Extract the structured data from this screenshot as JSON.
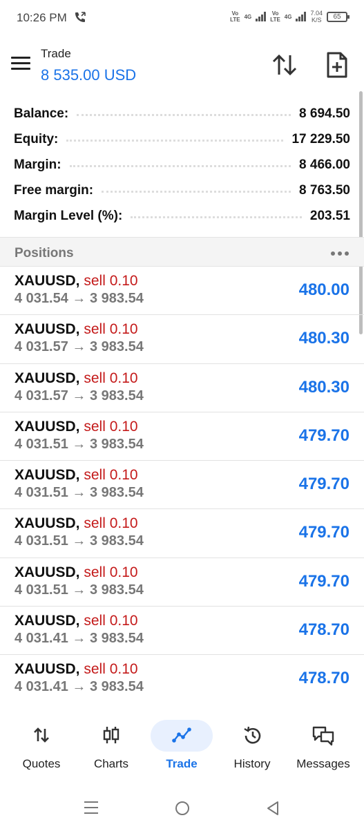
{
  "status_bar": {
    "time": "10:26 PM",
    "network_left": "Vo\nLTE",
    "signal_left": "4G",
    "network_right": "Vo\nLTE",
    "signal_right": "4G",
    "speed_value": "7.04",
    "speed_unit": "K/S",
    "battery": "65"
  },
  "header": {
    "title": "Trade",
    "balance": "8 535.00 USD"
  },
  "account": [
    {
      "label": "Balance:",
      "value": "8 694.50"
    },
    {
      "label": "Equity:",
      "value": "17 229.50"
    },
    {
      "label": "Margin:",
      "value": "8 466.00"
    },
    {
      "label": "Free margin:",
      "value": "8 763.50"
    },
    {
      "label": "Margin Level (%):",
      "value": "203.51"
    }
  ],
  "positions_section": {
    "title": "Positions"
  },
  "positions": [
    {
      "symbol": "XAUUSD,",
      "side": "sell 0.10",
      "open_price": "4 031.54",
      "arrow": "→",
      "current_price": "3 983.54",
      "profit": "480.00"
    },
    {
      "symbol": "XAUUSD,",
      "side": "sell 0.10",
      "open_price": "4 031.57",
      "arrow": "→",
      "current_price": "3 983.54",
      "profit": "480.30"
    },
    {
      "symbol": "XAUUSD,",
      "side": "sell 0.10",
      "open_price": "4 031.57",
      "arrow": "→",
      "current_price": "3 983.54",
      "profit": "480.30"
    },
    {
      "symbol": "XAUUSD,",
      "side": "sell 0.10",
      "open_price": "4 031.51",
      "arrow": "→",
      "current_price": "3 983.54",
      "profit": "479.70"
    },
    {
      "symbol": "XAUUSD,",
      "side": "sell 0.10",
      "open_price": "4 031.51",
      "arrow": "→",
      "current_price": "3 983.54",
      "profit": "479.70"
    },
    {
      "symbol": "XAUUSD,",
      "side": "sell 0.10",
      "open_price": "4 031.51",
      "arrow": "→",
      "current_price": "3 983.54",
      "profit": "479.70"
    },
    {
      "symbol": "XAUUSD,",
      "side": "sell 0.10",
      "open_price": "4 031.51",
      "arrow": "→",
      "current_price": "3 983.54",
      "profit": "479.70"
    },
    {
      "symbol": "XAUUSD,",
      "side": "sell 0.10",
      "open_price": "4 031.41",
      "arrow": "→",
      "current_price": "3 983.54",
      "profit": "478.70"
    },
    {
      "symbol": "XAUUSD,",
      "side": "sell 0.10",
      "open_price": "4 031.41",
      "arrow": "→",
      "current_price": "3 983.54",
      "profit": "478.70"
    }
  ],
  "bottom_nav": {
    "quotes": "Quotes",
    "charts": "Charts",
    "trade": "Trade",
    "history": "History",
    "messages": "Messages"
  },
  "icons": {
    "menu": "hamburger-menu-icon",
    "sort": "sort-arrows-icon",
    "new_order": "new-document-icon",
    "more": "more-dots-icon"
  },
  "colors": {
    "accent": "#1a73e8",
    "sell": "#c41a1a",
    "muted": "#777777"
  }
}
